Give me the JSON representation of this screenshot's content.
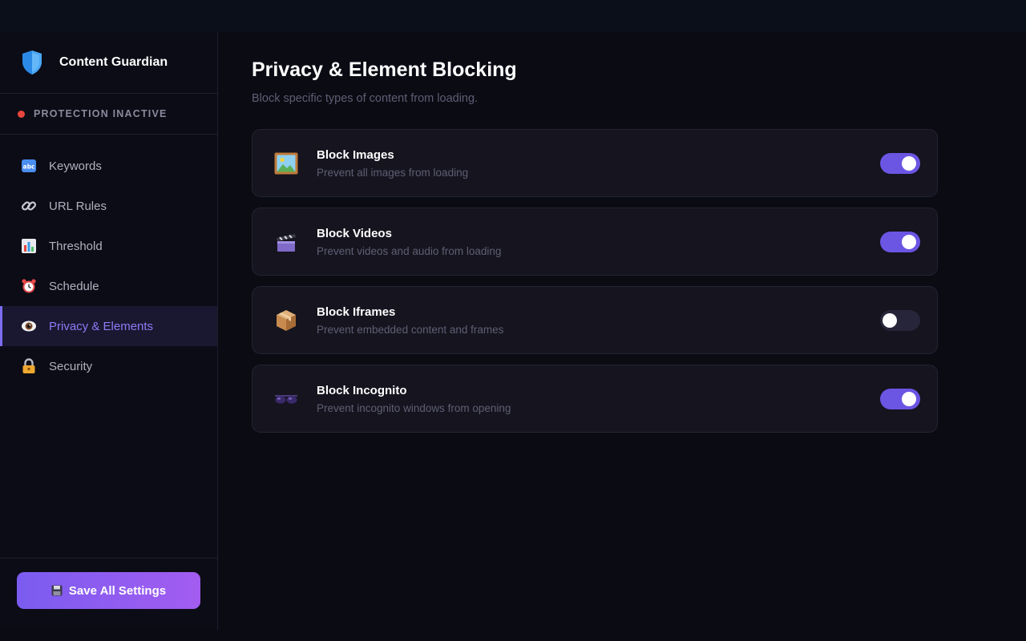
{
  "app": {
    "name": "Content Guardian",
    "status_text": "PROTECTION INACTIVE",
    "status_color": "#e8453c"
  },
  "sidebar": {
    "items": [
      {
        "label": "Keywords",
        "icon": "abc-icon",
        "active": false
      },
      {
        "label": "URL Rules",
        "icon": "link-icon",
        "active": false
      },
      {
        "label": "Threshold",
        "icon": "bar-chart-icon",
        "active": false
      },
      {
        "label": "Schedule",
        "icon": "alarm-clock-icon",
        "active": false
      },
      {
        "label": "Privacy & Elements",
        "icon": "eye-icon",
        "active": true
      },
      {
        "label": "Security",
        "icon": "lock-icon",
        "active": false
      }
    ],
    "save_label": "Save All Settings"
  },
  "main": {
    "title": "Privacy & Element Blocking",
    "subtitle": "Block specific types of content from loading.",
    "settings": [
      {
        "title": "Block Images",
        "description": "Prevent all images from loading",
        "icon": "framed-picture-icon",
        "enabled": true
      },
      {
        "title": "Block Videos",
        "description": "Prevent videos and audio from loading",
        "icon": "clapper-board-icon",
        "enabled": true
      },
      {
        "title": "Block Iframes",
        "description": "Prevent embedded content and frames",
        "icon": "package-icon",
        "enabled": false
      },
      {
        "title": "Block Incognito",
        "description": "Prevent incognito windows from opening",
        "icon": "sunglasses-icon",
        "enabled": true
      }
    ]
  },
  "colors": {
    "accent": "#7c6cf0",
    "toggle_on": "#6b55e3",
    "toggle_off": "#26253a",
    "background": "#0b0b14"
  }
}
